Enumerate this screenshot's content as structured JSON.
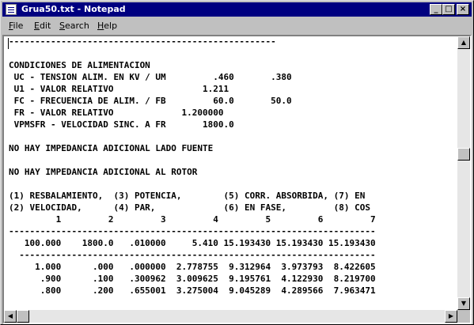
{
  "window": {
    "title": "Grua50.txt - Notepad",
    "buttons": {
      "minimize": "_",
      "maximize": "□",
      "close": "×"
    }
  },
  "menu": [
    {
      "label": "File"
    },
    {
      "label": "Edit"
    },
    {
      "label": "Search"
    },
    {
      "label": "Help"
    }
  ],
  "document": {
    "lines": [
      "---------------------------------------------------",
      "",
      "CONDICIONES DE ALIMENTACION",
      " UC - TENSION ALIM. EN KV / UM         .460       .380",
      " U1 - VALOR RELATIVO                 1.211",
      " FC - FRECUENCIA DE ALIM. / FB         60.0       50.0",
      " FR - VALOR RELATIVO             1.200000",
      " VPMSFR - VELOCIDAD SINC. A FR       1800.0",
      "",
      "NO HAY IMPEDANCIA ADICIONAL LADO FUENTE",
      "",
      "NO HAY IMPEDANCIA ADICIONAL AL ROTOR",
      "",
      "(1) RESBALAMIENTO,  (3) POTENCIA,        (5) CORR. ABSORBIDA, (7) EN",
      "(2) VELOCIDAD,      (4) PAR,             (6) EN FASE,         (8) COS",
      "         1         2         3         4         5         6         7",
      "----------------------------------------------------------------------",
      "   100.000    1800.0   .010000     5.410 15.193430 15.193430 15.193430",
      "  --------------------------------------------------------------------",
      "     1.000      .000   .000000  2.778755  9.312964  3.973793  8.422605",
      "      .900      .100   .300962  3.009625  9.195761  4.122930  8.219700",
      "      .800      .200   .655001  3.275004  9.045289  4.289566  7.963471"
    ]
  },
  "scrollbars": {
    "up": "▲",
    "down": "▼",
    "left": "◀",
    "right": "▶",
    "vertical_position": 0.42,
    "horizontal_position": 0.0
  }
}
